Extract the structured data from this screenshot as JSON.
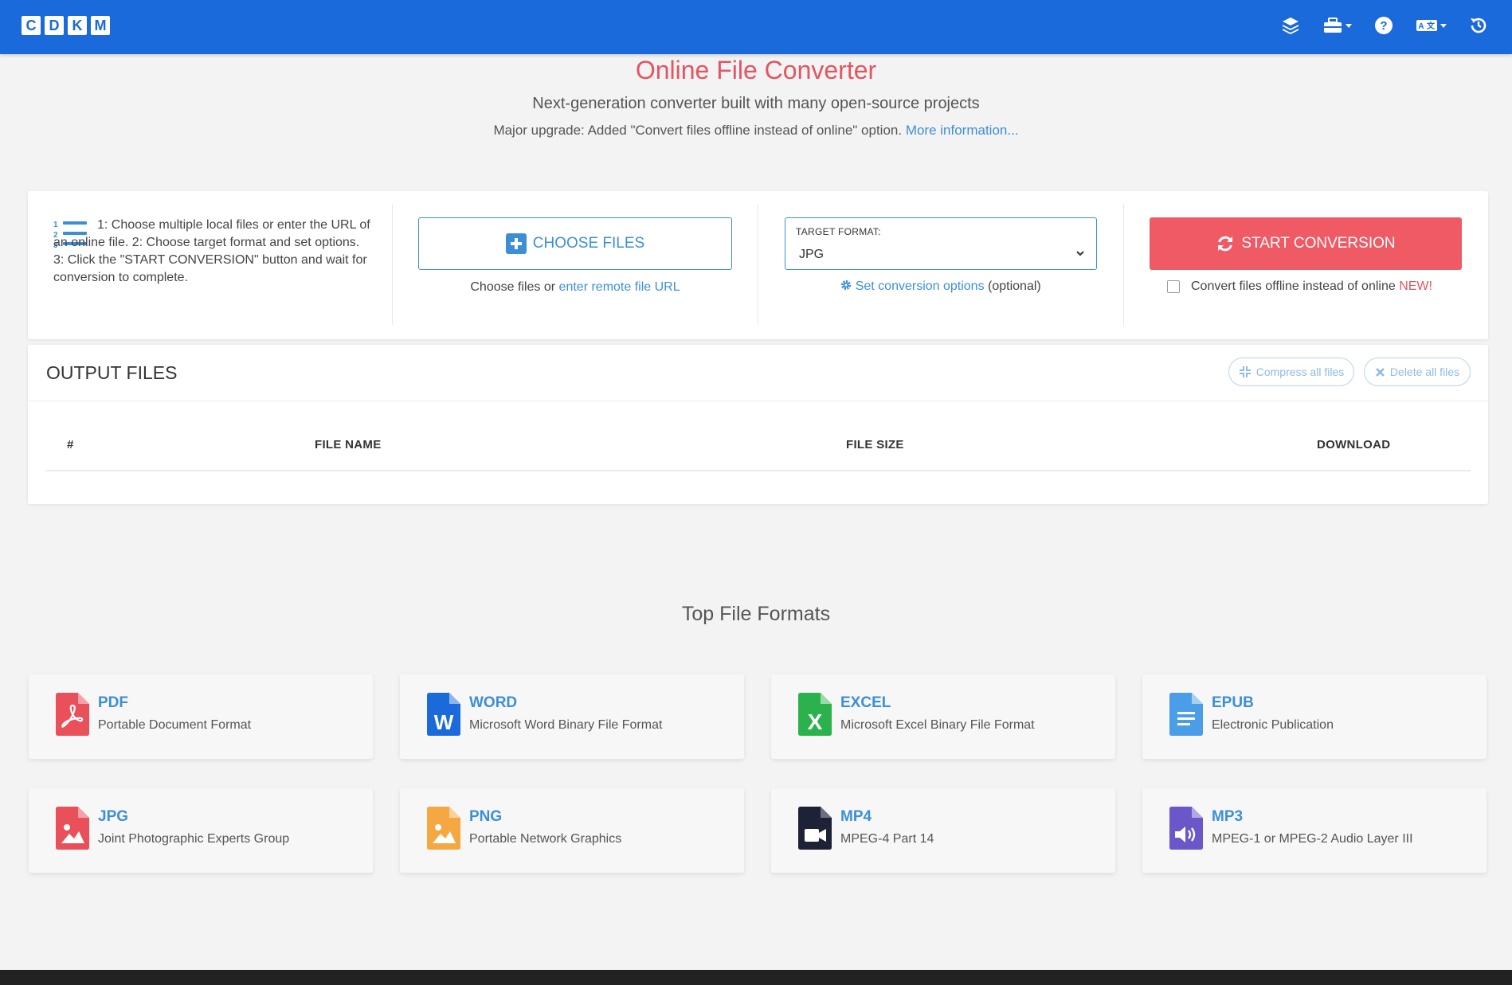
{
  "nav": {
    "logo_letters": [
      "C",
      "D",
      "K",
      "M"
    ],
    "icons": [
      "layers-icon",
      "toolbox-icon",
      "help-icon",
      "language-icon",
      "history-icon"
    ]
  },
  "hero": {
    "title": "Online File Converter",
    "subtitle": "Next-generation converter built with many open-source projects",
    "note": "Major upgrade: Added \"Convert files offline instead of online\" option.",
    "note_link": "More information..."
  },
  "converter": {
    "instructions": "1: Choose multiple local files or enter the URL of an online file. 2: Choose target format and set options. 3: Click the \"START CONVERSION\" button and wait for conversion to complete.",
    "choose_files_label": "CHOOSE FILES",
    "choose_sub_prefix": "Choose files or",
    "remote_url_link": "enter remote file URL",
    "target_format_label": "TARGET FORMAT:",
    "target_format_value": "JPG",
    "set_options_link": "Set conversion options",
    "set_options_suffix": "(optional)",
    "start_label": "START CONVERSION",
    "offline_label": "Convert files offline instead of online",
    "offline_new": "NEW!",
    "offline_checked": false
  },
  "output": {
    "title": "OUTPUT FILES",
    "compress_label": "Compress all files",
    "delete_label": "Delete all files",
    "columns": [
      "#",
      "FILE NAME",
      "FILE SIZE",
      "DOWNLOAD"
    ],
    "rows": []
  },
  "formats": {
    "title": "Top File Formats",
    "items": [
      {
        "name": "PDF",
        "desc": "Portable Document Format",
        "color": "#e9505a"
      },
      {
        "name": "WORD",
        "desc": "Microsoft Word Binary File Format",
        "color": "#1a6adb"
      },
      {
        "name": "EXCEL",
        "desc": "Microsoft Excel Binary File Format",
        "color": "#2bb24c"
      },
      {
        "name": "EPUB",
        "desc": "Electronic Publication",
        "color": "#4a9ee8"
      },
      {
        "name": "JPG",
        "desc": "Joint Photographic Experts Group",
        "color": "#e9505a"
      },
      {
        "name": "PNG",
        "desc": "Portable Network Graphics",
        "color": "#f5a742"
      },
      {
        "name": "MP4",
        "desc": "MPEG-4 Part 14",
        "color": "#1e2237"
      },
      {
        "name": "MP3",
        "desc": "MPEG-1 or MPEG-2 Audio Layer III",
        "color": "#6c57c9"
      }
    ]
  },
  "colors": {
    "nav_bg": "#1a6adb",
    "accent": "#3c8fd6",
    "danger": "#f05a64",
    "title_red": "#e25561"
  }
}
